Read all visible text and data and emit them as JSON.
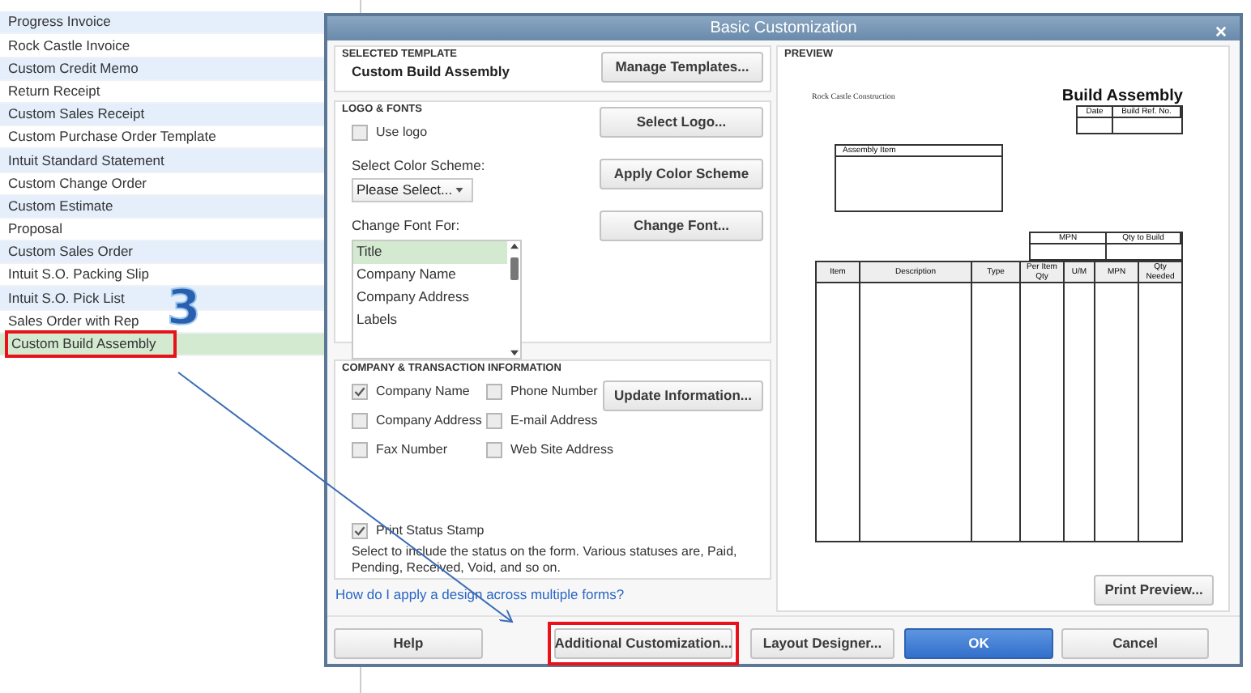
{
  "list": {
    "items": [
      {
        "label": "Progress Invoice",
        "selected": false,
        "highlighted": false
      },
      {
        "label": "Rock Castle Invoice",
        "selected": false,
        "highlighted": false
      },
      {
        "label": "Custom Credit Memo",
        "selected": false,
        "highlighted": false
      },
      {
        "label": "Return Receipt",
        "selected": false,
        "highlighted": false
      },
      {
        "label": "Custom Sales Receipt",
        "selected": false,
        "highlighted": false
      },
      {
        "label": "Custom Purchase Order Template",
        "selected": false,
        "highlighted": false
      },
      {
        "label": "Intuit Standard Statement",
        "selected": false,
        "highlighted": false
      },
      {
        "label": "Custom Change Order",
        "selected": false,
        "highlighted": false
      },
      {
        "label": "Custom Estimate",
        "selected": false,
        "highlighted": false
      },
      {
        "label": "Proposal",
        "selected": false,
        "highlighted": false
      },
      {
        "label": "Custom Sales Order",
        "selected": false,
        "highlighted": false
      },
      {
        "label": "Intuit S.O. Packing Slip",
        "selected": false,
        "highlighted": false
      },
      {
        "label": "Intuit S.O. Pick List",
        "selected": false,
        "highlighted": false
      },
      {
        "label": "Sales Order with Rep",
        "selected": false,
        "highlighted": false
      },
      {
        "label": "Custom Build Assembly",
        "selected": true,
        "highlighted": true
      }
    ]
  },
  "step_number": "3",
  "dialog": {
    "title": "Basic Customization",
    "selected_template": {
      "heading": "SELECTED TEMPLATE",
      "name": "Custom Build Assembly",
      "button": "Manage Templates..."
    },
    "logo_fonts": {
      "heading": "LOGO & FONTS",
      "use_logo": {
        "label": "Use logo",
        "checked": false
      },
      "select_logo_button": "Select Logo...",
      "color_scheme_label": "Select Color Scheme:",
      "color_scheme_value": "Please Select...",
      "apply_button": "Apply Color Scheme",
      "change_font_label": "Change Font For:",
      "font_items": [
        {
          "label": "Title",
          "selected": true
        },
        {
          "label": "Company Name",
          "selected": false
        },
        {
          "label": "Company Address",
          "selected": false
        },
        {
          "label": "Labels",
          "selected": false
        }
      ],
      "change_font_button": "Change Font..."
    },
    "company_info": {
      "heading": "COMPANY & TRANSACTION INFORMATION",
      "checkboxes": [
        {
          "label": "Company Name",
          "checked": true
        },
        {
          "label": "Phone Number",
          "checked": false
        },
        {
          "label": "Company Address",
          "checked": false
        },
        {
          "label": "E-mail Address",
          "checked": false
        },
        {
          "label": "Fax Number",
          "checked": false
        },
        {
          "label": "Web Site Address",
          "checked": false
        }
      ],
      "update_button": "Update Information...",
      "print_status_stamp": {
        "label": "Print Status Stamp",
        "checked": true
      },
      "description": "Select to include the status on the form. Various statuses are, Paid, Pending, Received, Void, and so on."
    },
    "help_link": "How do I apply a design across multiple forms?",
    "preview": {
      "heading": "PREVIEW",
      "company": "Rock Castle Construction",
      "form_title": "Build Assembly",
      "header_columns": [
        "Date",
        "Build Ref. No."
      ],
      "assembly_label": "Assembly Item",
      "qty_columns": [
        "MPN",
        "Qty to Build"
      ],
      "item_columns": [
        "Item",
        "Description",
        "Type",
        "Per Item Qty",
        "U/M",
        "MPN",
        "Qty Needed"
      ],
      "print_preview_button": "Print Preview..."
    },
    "buttons": [
      {
        "label": "Help",
        "kind": "normal",
        "highlighted": false
      },
      {
        "label": "Additional Customization...",
        "kind": "normal",
        "highlighted": true
      },
      {
        "label": "Layout Designer...",
        "kind": "normal",
        "highlighted": false
      },
      {
        "label": "OK",
        "kind": "primary",
        "highlighted": false
      },
      {
        "label": "Cancel",
        "kind": "normal",
        "highlighted": false
      }
    ]
  }
}
